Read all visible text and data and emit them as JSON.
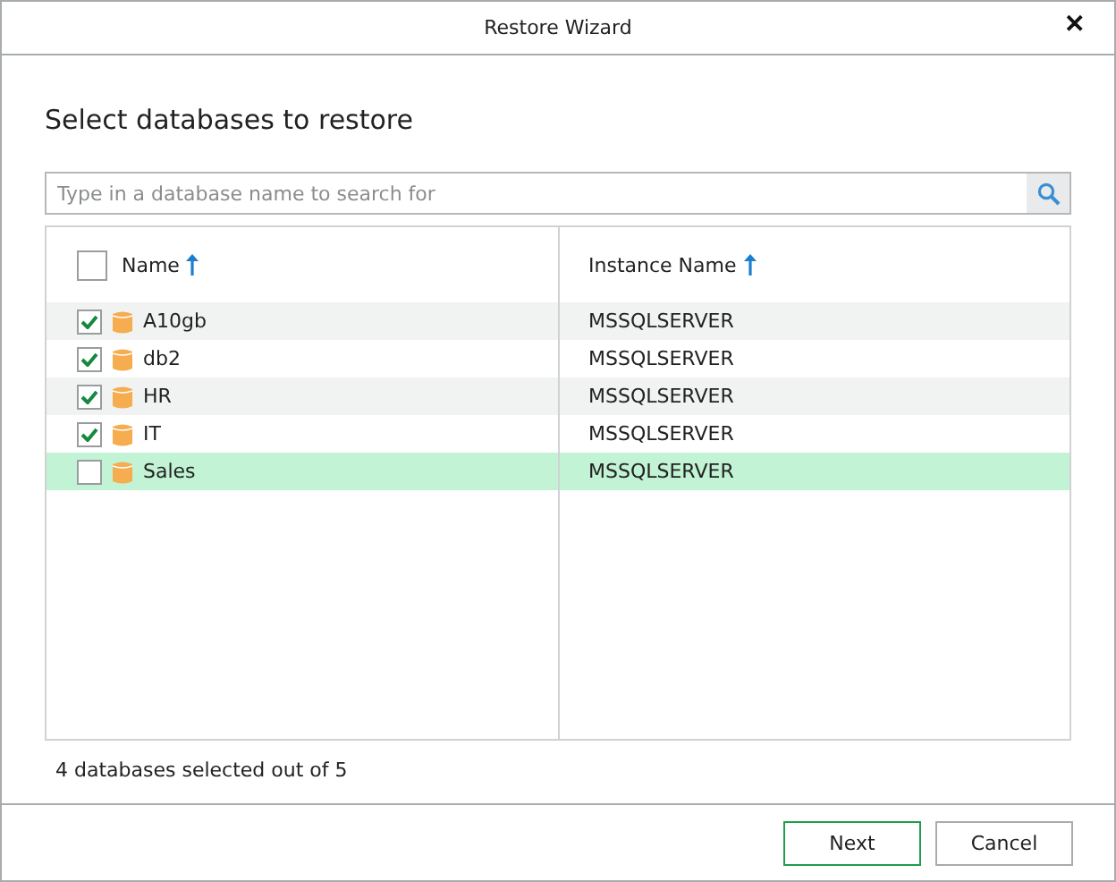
{
  "window": {
    "title": "Restore Wizard",
    "close": "✕"
  },
  "heading": "Select databases to restore",
  "search": {
    "placeholder": "Type in a database name to search for"
  },
  "table": {
    "select_all": {
      "checked": false
    },
    "columns": [
      {
        "label": "Name",
        "sorted_ascending": true
      },
      {
        "label": "Instance Name",
        "sorted_ascending": true
      }
    ],
    "rows": [
      {
        "name": "A10gb",
        "instance": "MSSQLSERVER",
        "checked": true,
        "selected": false
      },
      {
        "name": "db2",
        "instance": "MSSQLSERVER",
        "checked": true,
        "selected": false
      },
      {
        "name": "HR",
        "instance": "MSSQLSERVER",
        "checked": true,
        "selected": false
      },
      {
        "name": "IT",
        "instance": "MSSQLSERVER",
        "checked": true,
        "selected": false
      },
      {
        "name": "Sales",
        "instance": "MSSQLSERVER",
        "checked": false,
        "selected": true
      }
    ]
  },
  "status": "4 databases selected out of 5",
  "buttons": [
    {
      "label": "Next",
      "kind": "default"
    },
    {
      "label": "Cancel",
      "kind": "normal"
    }
  ]
}
